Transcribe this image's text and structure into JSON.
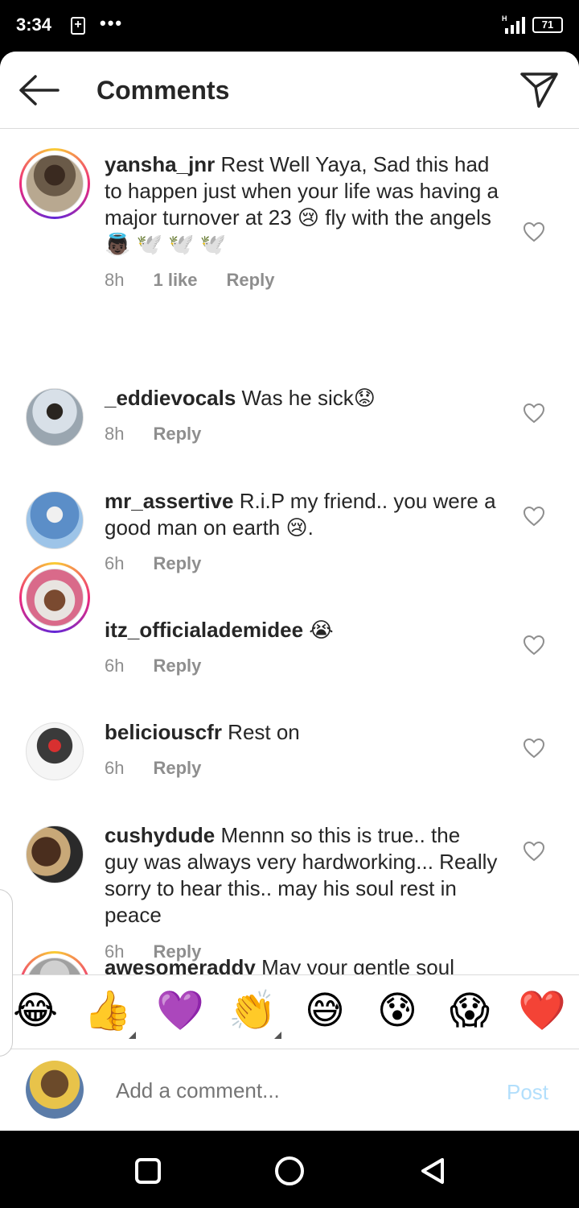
{
  "status_bar": {
    "time": "3:34",
    "dots": "•••",
    "network": "H",
    "battery": "71"
  },
  "header": {
    "title": "Comments"
  },
  "comments": [
    {
      "user": "yansha_jnr",
      "text": " Rest Well Yaya, Sad this had to happen just when your life was having a major turnover at 23 😢  fly with the angels 👼🏿 🕊️ 🕊️ 🕊️",
      "time": "8h",
      "likes": "1 like",
      "reply": "Reply"
    },
    {
      "user": "_eddievocals",
      "text": " Was he sick😟",
      "time": "8h",
      "likes": "",
      "reply": "Reply"
    },
    {
      "user": "mr_assertive",
      "text": " R.i.P my friend.. you were a good man on earth 😢.",
      "time": "6h",
      "likes": "",
      "reply": "Reply"
    },
    {
      "user": "itz_officialademidee",
      "text": " 😭",
      "time": "6h",
      "likes": "",
      "reply": "Reply"
    },
    {
      "user": "beliciouscfr",
      "text": " Rest on",
      "time": "6h",
      "likes": "",
      "reply": "Reply"
    },
    {
      "user": "cushydude",
      "text": " Mennn so this is true.. the guy was always very hardworking... Really sorry to hear this.. may his soul rest in peace",
      "time": "6h",
      "likes": "",
      "reply": "Reply"
    },
    {
      "user": "awesomeraddy",
      "text": " May your gentle soul",
      "time": "",
      "likes": "",
      "reply": ""
    }
  ],
  "emoji_bar": [
    "😂",
    "👍",
    "💜",
    "👏",
    "😅",
    "😰",
    "😱",
    "❤️"
  ],
  "compose": {
    "placeholder": "Add a comment...",
    "post_label": "Post"
  },
  "colors": {
    "accent_disabled": "#b2dffc",
    "meta_gray": "#8e8e8e",
    "text": "#262626"
  }
}
